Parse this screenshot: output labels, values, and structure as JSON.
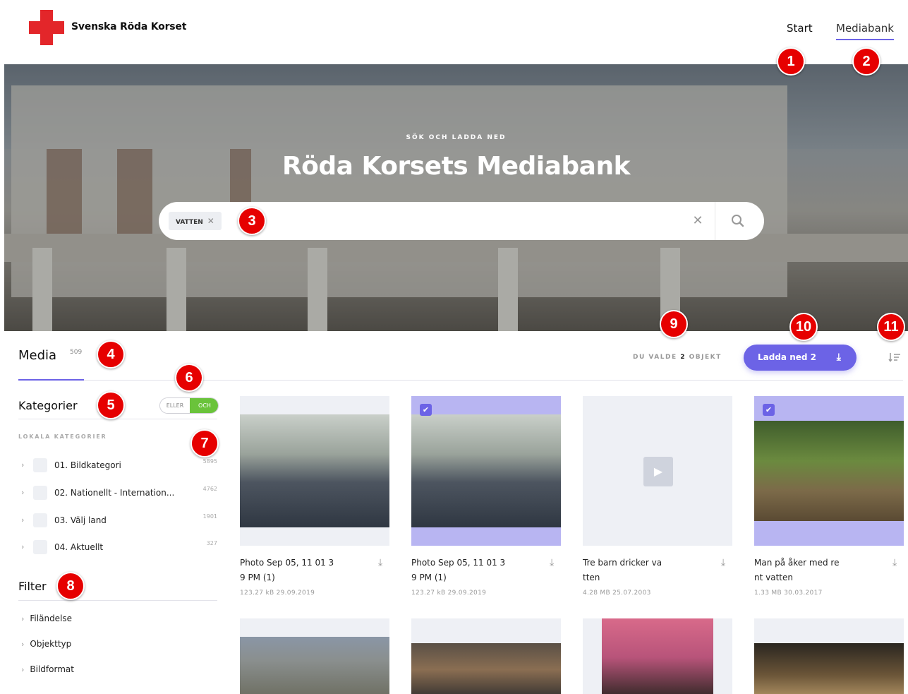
{
  "header": {
    "brand": "Svenska Röda Korset",
    "nav": [
      {
        "label": "Start"
      },
      {
        "label": "Mediabank"
      }
    ]
  },
  "hero": {
    "kicker": "SÖK OCH LADDA NED",
    "title": "Röda Korsets Mediabank"
  },
  "search": {
    "chips": [
      {
        "label": "VATTEN"
      }
    ]
  },
  "toolbar": {
    "media_label": "Media",
    "media_count": "509",
    "selected_prefix": "DU VALDE",
    "selected_count": "2",
    "selected_suffix": "OBJEKT",
    "download_label": "Ladda ned 2"
  },
  "sidebar": {
    "categories_heading": "Kategorier",
    "toggle": {
      "left": "ELLER",
      "right": "OCH",
      "active": "OCH"
    },
    "local_heading": "LOKALA KATEGORIER",
    "categories": [
      {
        "label": "01. Bildkategori",
        "count": "5895"
      },
      {
        "label": "02. Nationellt - Internation...",
        "count": "4762"
      },
      {
        "label": "03. Välj land",
        "count": "1901"
      },
      {
        "label": "04. Aktuellt",
        "count": "327"
      }
    ],
    "filter_heading": "Filter",
    "filters": [
      {
        "label": "Filändelse"
      },
      {
        "label": "Objekttyp"
      },
      {
        "label": "Bildformat"
      }
    ]
  },
  "media": [
    {
      "title_line1": "Photo Sep 05, 11 01 3",
      "title_line2": "9 PM (1)",
      "meta": "123.27 kB 29.09.2019",
      "selected": false,
      "type": "image"
    },
    {
      "title_line1": "Photo Sep 05, 11 01 3",
      "title_line2": "9 PM (1)",
      "meta": "123.27 kB 29.09.2019",
      "selected": true,
      "type": "image"
    },
    {
      "title_line1": "Tre barn dricker va",
      "title_line2": "tten",
      "meta": "4.28 MB 25.07.2003",
      "selected": false,
      "type": "video"
    },
    {
      "title_line1": "Man på åker med re",
      "title_line2": "nt vatten",
      "meta": "1.33 MB 30.03.2017",
      "selected": true,
      "type": "image"
    }
  ],
  "annotations": [
    "1",
    "2",
    "3",
    "4",
    "5",
    "6",
    "7",
    "8",
    "9",
    "10",
    "11"
  ],
  "colors": {
    "accent": "#6c63e6",
    "brand_red": "#e3262a",
    "toggle_on": "#6ac33b",
    "marker": "#e60000"
  }
}
